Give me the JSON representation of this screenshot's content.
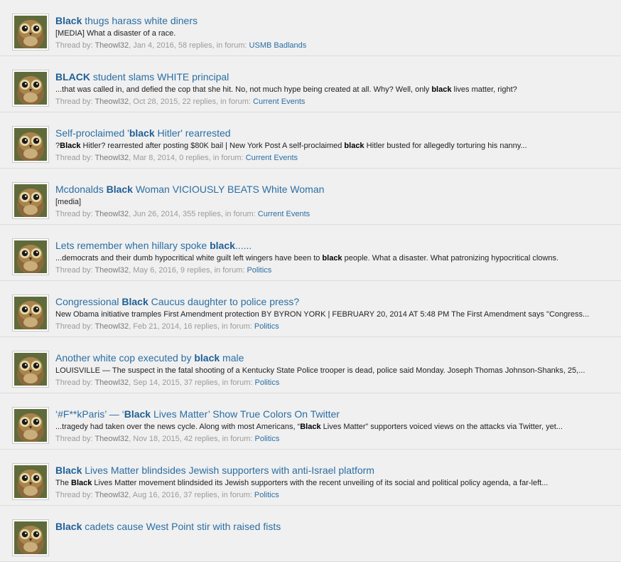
{
  "results": [
    {
      "title": [
        {
          "t": "Black",
          "b": true
        },
        {
          "t": " thugs harass white diners",
          "b": false
        }
      ],
      "snippet": [
        {
          "t": "[MEDIA] What a disaster of a race.",
          "b": false
        }
      ],
      "thread_by_label": "Thread by:",
      "author": "Theowl32",
      "details": ", Jan 4, 2016, 58 replies, in forum:",
      "forum": "USMB Badlands"
    },
    {
      "title": [
        {
          "t": "BLACK",
          "b": true
        },
        {
          "t": " student slams WHITE principal",
          "b": false
        }
      ],
      "snippet": [
        {
          "t": "...that was called in, and defied the cop that she hit. No, not much hype being created at all. Why? Well, only ",
          "b": false
        },
        {
          "t": "black",
          "b": true
        },
        {
          "t": " lives matter, right?",
          "b": false
        }
      ],
      "thread_by_label": "Thread by:",
      "author": "Theowl32",
      "details": ", Oct 28, 2015, 22 replies, in forum:",
      "forum": "Current Events"
    },
    {
      "title": [
        {
          "t": "Self-proclaimed '",
          "b": false
        },
        {
          "t": "black",
          "b": true
        },
        {
          "t": " Hitler' rearrested",
          "b": false
        }
      ],
      "snippet": [
        {
          "t": "?",
          "b": false
        },
        {
          "t": "Black",
          "b": true
        },
        {
          "t": " Hitler? rearrested after posting $80K bail | New York Post A self-proclaimed ",
          "b": false
        },
        {
          "t": "black",
          "b": true
        },
        {
          "t": " Hitler busted for allegedly torturing his nanny...",
          "b": false
        }
      ],
      "thread_by_label": "Thread by:",
      "author": "Theowl32",
      "details": ", Mar 8, 2014, 0 replies, in forum:",
      "forum": "Current Events"
    },
    {
      "title": [
        {
          "t": "Mcdonalds ",
          "b": false
        },
        {
          "t": "Black",
          "b": true
        },
        {
          "t": " Woman VICIOUSLY BEATS White Woman",
          "b": false
        }
      ],
      "snippet": [
        {
          "t": "[media]",
          "b": false
        }
      ],
      "thread_by_label": "Thread by:",
      "author": "Theowl32",
      "details": ", Jun 26, 2014, 355 replies, in forum:",
      "forum": "Current Events"
    },
    {
      "title": [
        {
          "t": "Lets remember when hillary spoke ",
          "b": false
        },
        {
          "t": "black",
          "b": true
        },
        {
          "t": "......",
          "b": false
        }
      ],
      "snippet": [
        {
          "t": "...democrats and their dumb hypocritical white guilt left wingers have been to ",
          "b": false
        },
        {
          "t": "black",
          "b": true
        },
        {
          "t": " people. What a disaster. What patronizing hypocritical clowns.",
          "b": false
        }
      ],
      "thread_by_label": "Thread by:",
      "author": "Theowl32",
      "details": ", May 6, 2016, 9 replies, in forum:",
      "forum": "Politics"
    },
    {
      "title": [
        {
          "t": "Congressional ",
          "b": false
        },
        {
          "t": "Black",
          "b": true
        },
        {
          "t": " Caucus daughter to police press?",
          "b": false
        }
      ],
      "snippet": [
        {
          "t": "New Obama initiative tramples First Amendment protection BY BYRON YORK | FEBRUARY 20, 2014 AT 5:48 PM The First Amendment says \"Congress...",
          "b": false
        }
      ],
      "thread_by_label": "Thread by:",
      "author": "Theowl32",
      "details": ", Feb 21, 2014, 16 replies, in forum:",
      "forum": "Politics"
    },
    {
      "title": [
        {
          "t": "Another white cop executed by ",
          "b": false
        },
        {
          "t": "black",
          "b": true
        },
        {
          "t": " male",
          "b": false
        }
      ],
      "snippet": [
        {
          "t": "LOUISVILLE — The suspect in the fatal shooting of a Kentucky State Police trooper is dead, police said Monday. Joseph Thomas Johnson-Shanks, 25,...",
          "b": false
        }
      ],
      "thread_by_label": "Thread by:",
      "author": "Theowl32",
      "details": ", Sep 14, 2015, 37 replies, in forum:",
      "forum": "Politics"
    },
    {
      "title": [
        {
          "t": "‘#F**kParis’ — ‘",
          "b": false
        },
        {
          "t": "Black",
          "b": true
        },
        {
          "t": " Lives Matter’ Show True Colors On Twitter",
          "b": false
        }
      ],
      "snippet": [
        {
          "t": "...tragedy had taken over the news cycle. Along with most Americans, “",
          "b": false
        },
        {
          "t": "Black",
          "b": true
        },
        {
          "t": " Lives Matter” supporters voiced views on the attacks via Twitter, yet...",
          "b": false
        }
      ],
      "thread_by_label": "Thread by:",
      "author": "Theowl32",
      "details": ", Nov 18, 2015, 42 replies, in forum:",
      "forum": "Politics"
    },
    {
      "title": [
        {
          "t": "Black",
          "b": true
        },
        {
          "t": " Lives Matter blindsides Jewish supporters with anti-Israel platform",
          "b": false
        }
      ],
      "snippet": [
        {
          "t": "The ",
          "b": false
        },
        {
          "t": "Black",
          "b": true
        },
        {
          "t": " Lives Matter movement blindsided its Jewish supporters with the recent unveiling of its social and political policy agenda, a far-left...",
          "b": false
        }
      ],
      "thread_by_label": "Thread by:",
      "author": "Theowl32",
      "details": ", Aug 16, 2016, 37 replies, in forum:",
      "forum": "Politics"
    },
    {
      "title": [
        {
          "t": "Black",
          "b": true
        },
        {
          "t": " cadets cause West Point stir with raised fists",
          "b": false
        }
      ],
      "snippet": [],
      "thread_by_label": "",
      "author": "",
      "details": "",
      "forum": ""
    }
  ]
}
